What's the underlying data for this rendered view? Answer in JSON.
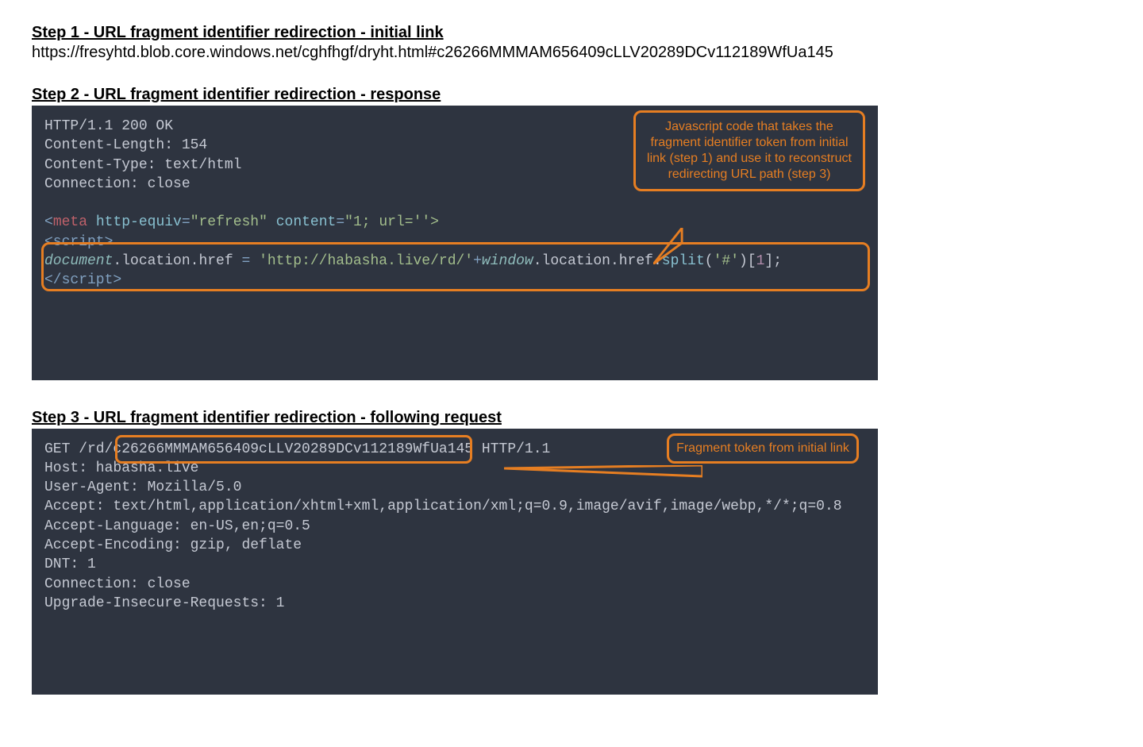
{
  "step1": {
    "title": "Step 1 - URL fragment identifier redirection - initial link",
    "url": "https://fresyhtd.blob.core.windows.net/cghfhgf/dryht.html#c26266MMMAM656409cLLV20289DCv112189WfUa145"
  },
  "step2": {
    "title": "Step 2 - URL fragment identifier redirection - response",
    "http_status": "HTTP/1.1 200 OK",
    "content_length": "Content-Length: 154",
    "content_type": "Content-Type: text/html",
    "connection": "Connection: close",
    "meta_open": "<",
    "meta_tag": "meta",
    "meta_sp1": " ",
    "meta_attr1": "http-equiv",
    "meta_eq1": "=",
    "meta_val1": "\"refresh\"",
    "meta_sp2": " ",
    "meta_attr2": "content",
    "meta_eq2": "=",
    "meta_val2": "\"1; url=''>",
    "script_open": "<script>",
    "doc": "document",
    "loc1": ".location.href ",
    "assign": "= ",
    "str1": "'http://habasha.live/rd/'",
    "plus": "+",
    "win": "window",
    "loc2": ".location.href.",
    "split": "split",
    "lpar": "(",
    "hash": "'#'",
    "rpar": ")[",
    "one": "1",
    "end": "];",
    "script_close": "</script>",
    "callout": "Javascript code that takes the fragment identifier token from initial link (step 1) and use it to reconstruct redirecting URL path (step 3)"
  },
  "step3": {
    "title": "Step 3 - URL fragment identifier redirection - following request",
    "get_prefix": "GET /rd/",
    "token": "c26266MMMAM656409cLLV20289DCv112189WfUa145",
    "get_suffix": " HTTP/1.1",
    "host": "Host: habasha.live",
    "ua": "User-Agent: Mozilla/5.0",
    "accept": "Accept: text/html,application/xhtml+xml,application/xml;q=0.9,image/avif,image/webp,*/*;q=0.8",
    "lang": "Accept-Language: en-US,en;q=0.5",
    "enc": "Accept-Encoding: gzip, deflate",
    "dnt": "DNT: 1",
    "conn": "Connection: close",
    "upgrade": "Upgrade-Insecure-Requests: 1",
    "callout": "Fragment token from initial link"
  }
}
